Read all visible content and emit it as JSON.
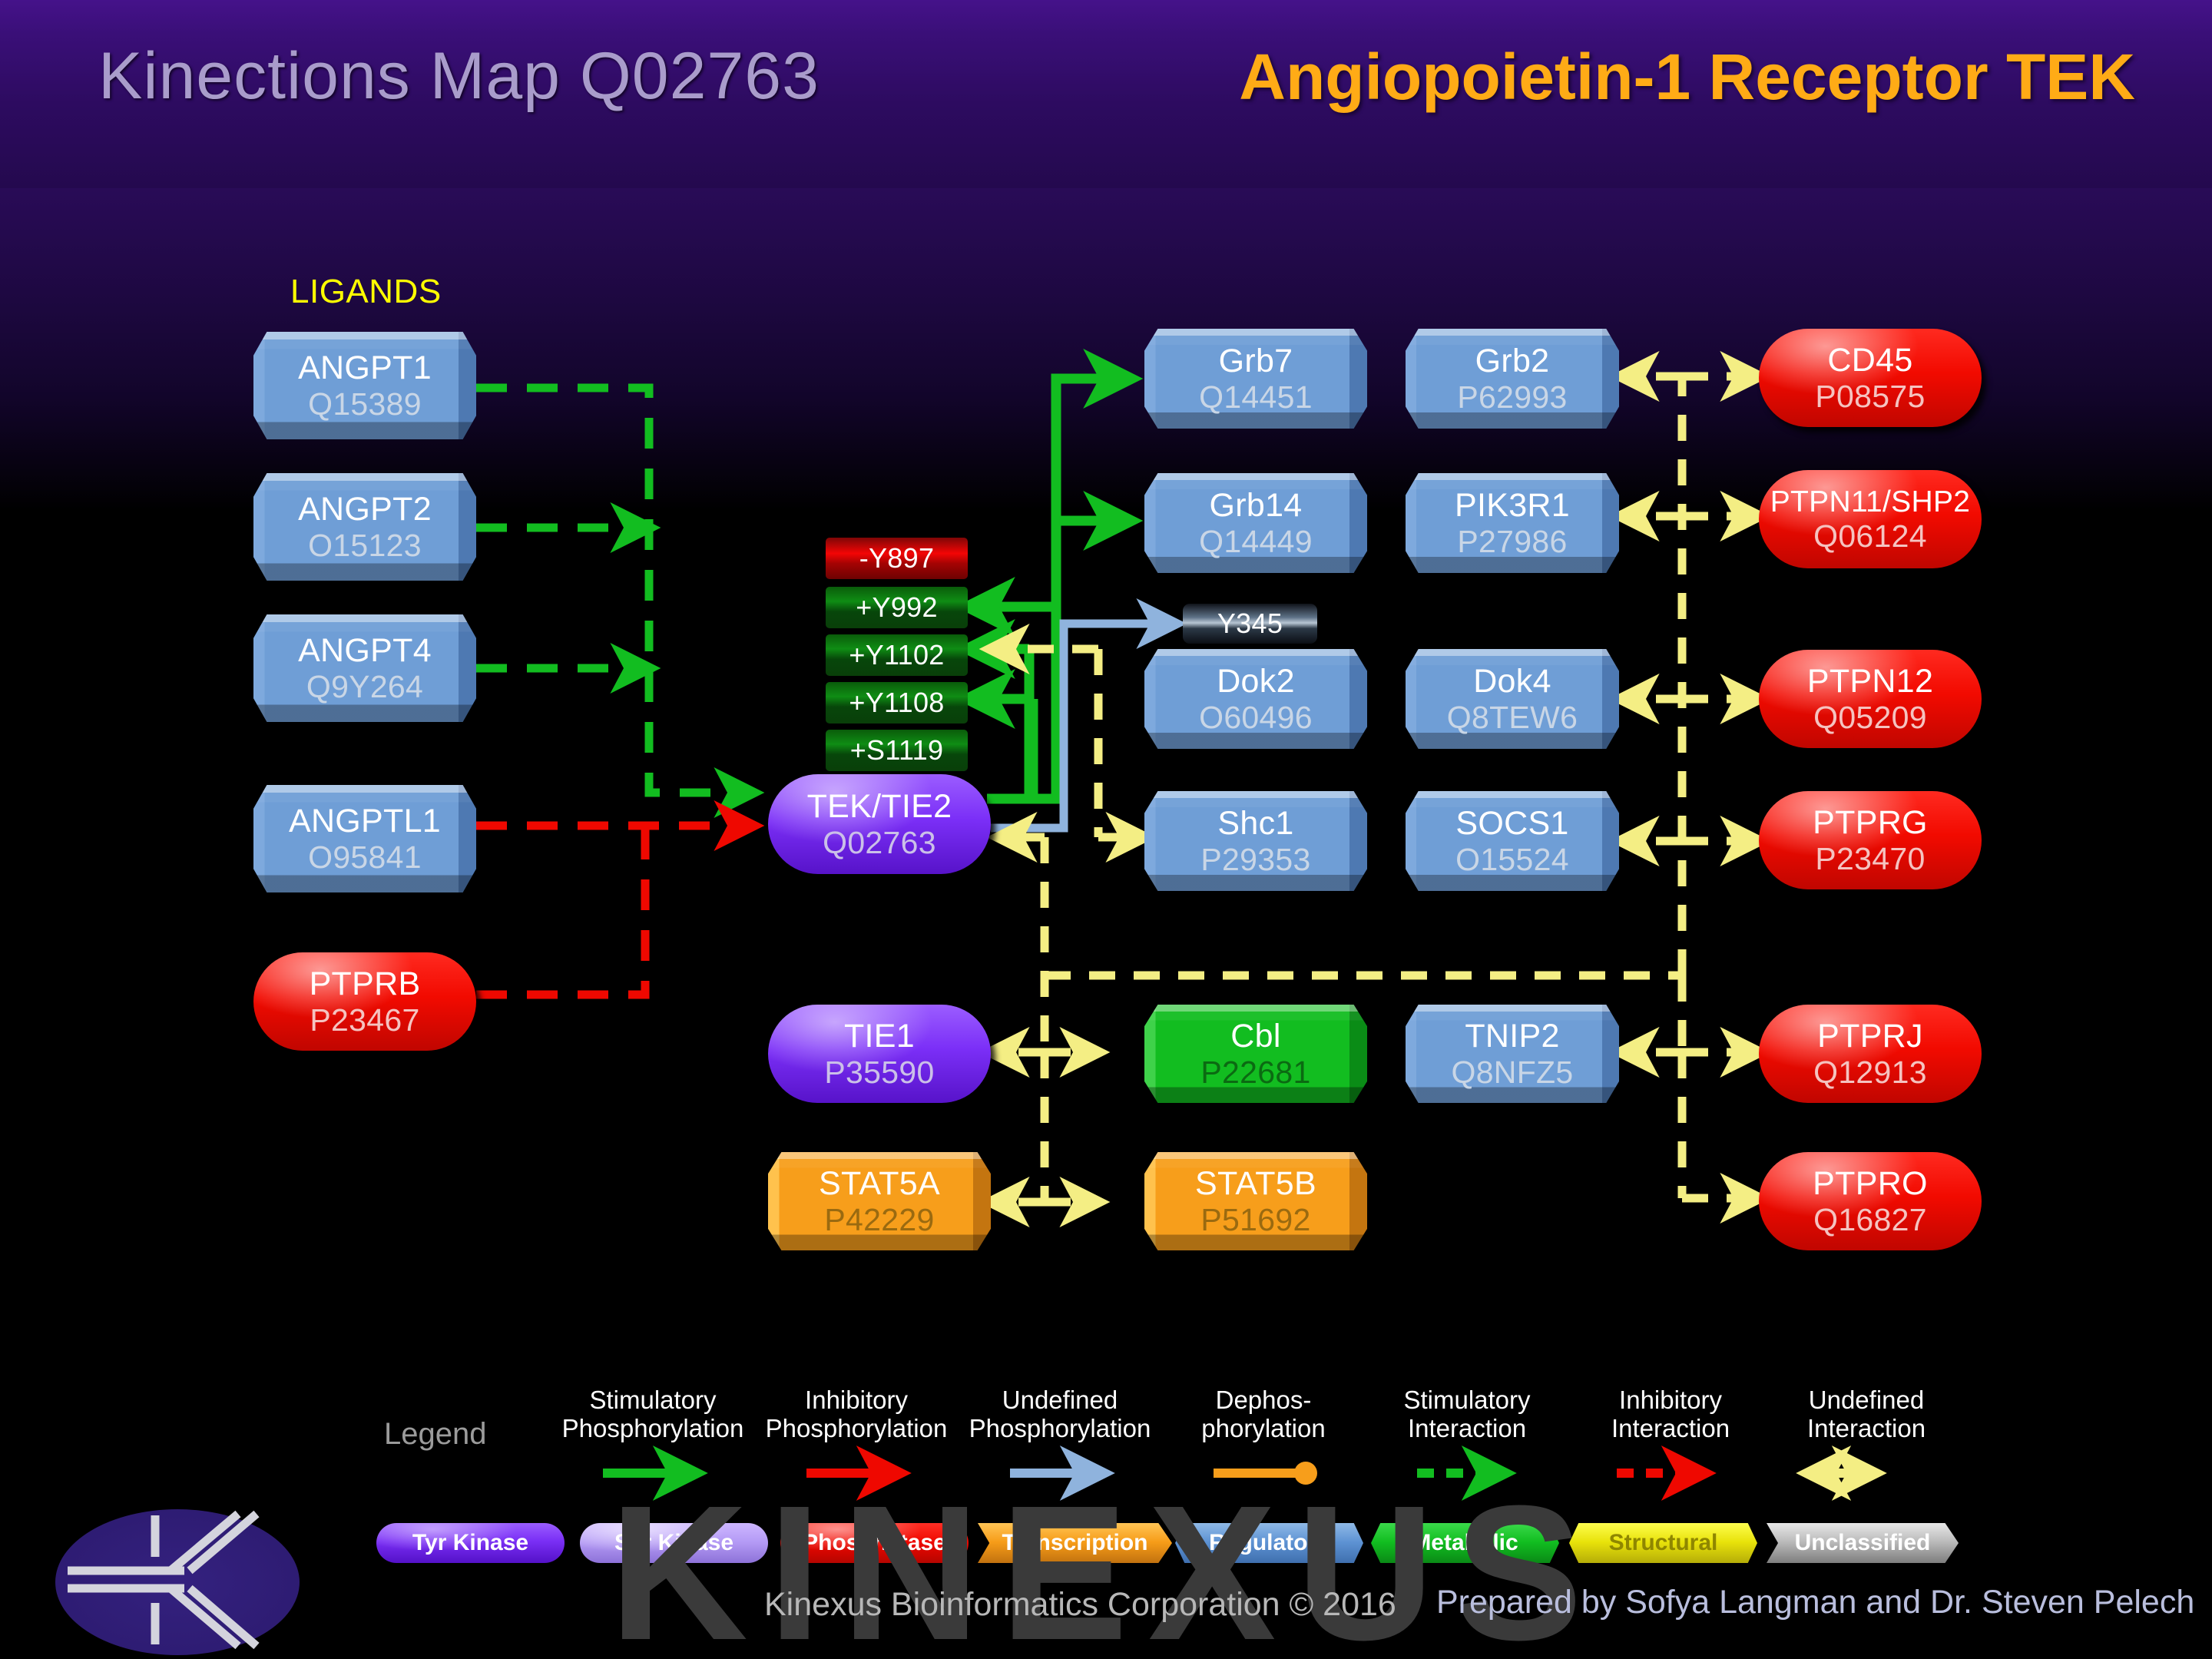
{
  "header": {
    "left_title": "Kinections Map Q02763",
    "right_title": "Angiopoietin-1 Receptor TEK"
  },
  "sections": {
    "ligands_label": "LIGANDS"
  },
  "nodes": {
    "angpt1": {
      "name": "ANGPT1",
      "accession": "Q15389"
    },
    "angpt2": {
      "name": "ANGPT2",
      "accession": "O15123"
    },
    "angpt4": {
      "name": "ANGPT4",
      "accession": "Q9Y264"
    },
    "angptl1": {
      "name": "ANGPTL1",
      "accession": "O95841"
    },
    "ptprb": {
      "name": "PTPRB",
      "accession": "P23467"
    },
    "tek": {
      "name": "TEK/TIE2",
      "accession": "Q02763"
    },
    "grb7": {
      "name": "Grb7",
      "accession": "Q14451"
    },
    "grb14": {
      "name": "Grb14",
      "accession": "Q14449"
    },
    "dok2": {
      "name": "Dok2",
      "accession": "O60496"
    },
    "shc1": {
      "name": "Shc1",
      "accession": "P29353"
    },
    "grb2": {
      "name": "Grb2",
      "accession": "P62993"
    },
    "pik3r1": {
      "name": "PIK3R1",
      "accession": "P27986"
    },
    "dok4": {
      "name": "Dok4",
      "accession": "Q8TEW6"
    },
    "socs1": {
      "name": "SOCS1",
      "accession": "O15524"
    },
    "cd45": {
      "name": "CD45",
      "accession": "P08575"
    },
    "ptpn11": {
      "name": "PTPN11/SHP2",
      "accession": "Q06124"
    },
    "ptpn12": {
      "name": "PTPN12",
      "accession": "Q05209"
    },
    "ptprg": {
      "name": "PTPRG",
      "accession": "P23470"
    },
    "tie1": {
      "name": "TIE1",
      "accession": "P35590"
    },
    "cbl": {
      "name": "Cbl",
      "accession": "P22681"
    },
    "tnip2": {
      "name": "TNIP2",
      "accession": "Q8NFZ5"
    },
    "ptprj": {
      "name": "PTPRJ",
      "accession": "Q12913"
    },
    "stat5a": {
      "name": "STAT5A",
      "accession": "P42229"
    },
    "stat5b": {
      "name": "STAT5B",
      "accession": "P51692"
    },
    "ptpro": {
      "name": "PTPRO",
      "accession": "Q16827"
    }
  },
  "phosphosites": {
    "y897": "-Y897",
    "y992": "+Y992",
    "y1102": "+Y1102",
    "y1108": "+Y1108",
    "s1119": "+S1119",
    "y345": "Y345"
  },
  "legend": {
    "title": "Legend",
    "items": [
      {
        "l1": "Stimulatory",
        "l2": "Phosphorylation",
        "arrow": "solid",
        "color": "#12bd20"
      },
      {
        "l1": "Inhibitory",
        "l2": "Phosphorylation",
        "arrow": "solid",
        "color": "#ef0800"
      },
      {
        "l1": "Undefined",
        "l2": "Phosphorylation",
        "arrow": "solid",
        "color": "#8fb3dd"
      },
      {
        "l1": "Dephos-",
        "l2": "phorylation",
        "arrow": "bar",
        "color": "#f79e1b"
      },
      {
        "l1": "Stimulatory",
        "l2": "Interaction",
        "arrow": "dashed",
        "color": "#12bd20"
      },
      {
        "l1": "Inhibitory",
        "l2": "Interaction",
        "arrow": "dashed",
        "color": "#ef0800"
      },
      {
        "l1": "Undefined",
        "l2": "Interaction",
        "arrow": "bidash",
        "color": "#f4ee84"
      }
    ],
    "classes": [
      {
        "label": "Tyr Kinase",
        "shape": "pill",
        "color": "#7a2ff5"
      },
      {
        "label": "Ser Kinase",
        "shape": "pill",
        "color": "#b49af5"
      },
      {
        "label": "Phosphatase",
        "shape": "pill",
        "color": "#ef0800"
      },
      {
        "label": "Transcription",
        "shape": "arrow",
        "color": "#f69c18"
      },
      {
        "label": "Regulatory",
        "shape": "hex",
        "color": "#5d92d3"
      },
      {
        "label": "Metabolic",
        "shape": "hex",
        "color": "#11bd20"
      },
      {
        "label": "Structural",
        "shape": "hex",
        "color": "#e8e20a"
      },
      {
        "label": "Unclassified",
        "shape": "arrow",
        "color": "#b9b9b9"
      }
    ]
  },
  "footer": {
    "watermark": "KINEXUS",
    "copyright": "Kinexus Bioinformatics Corporation © 2016",
    "credit": "Prepared by Sofya Langman and Dr. Steven Pelech"
  }
}
